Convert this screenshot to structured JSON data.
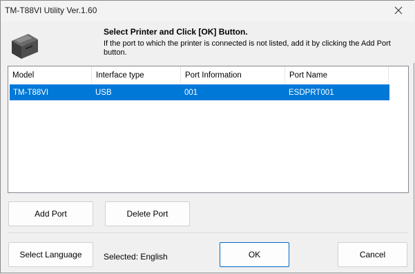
{
  "window": {
    "title": "TM-T88VI Utility Ver.1.60"
  },
  "header": {
    "heading": "Select Printer and Click [OK] Button.",
    "subtext": "If the port to which the printer is connected is not listed, add it by clicking the Add Port button."
  },
  "printer_list": {
    "columns": [
      "Model",
      "Interface type",
      "Port Information",
      "Port Name"
    ],
    "rows": [
      {
        "model": "TM-T88VI",
        "interface": "USB",
        "port_info": "001",
        "port_name": "ESDPRT001",
        "selected": true
      }
    ]
  },
  "buttons": {
    "add_port": "Add Port",
    "delete_port": "Delete Port",
    "select_language": "Select Language",
    "ok": "OK",
    "cancel": "Cancel"
  },
  "language": {
    "selected_text": "Selected: English"
  },
  "icons": {
    "printer": "printer-icon",
    "close": "close-icon"
  },
  "colors": {
    "selection": "#0078d7",
    "default_button_border": "#0067c0"
  }
}
